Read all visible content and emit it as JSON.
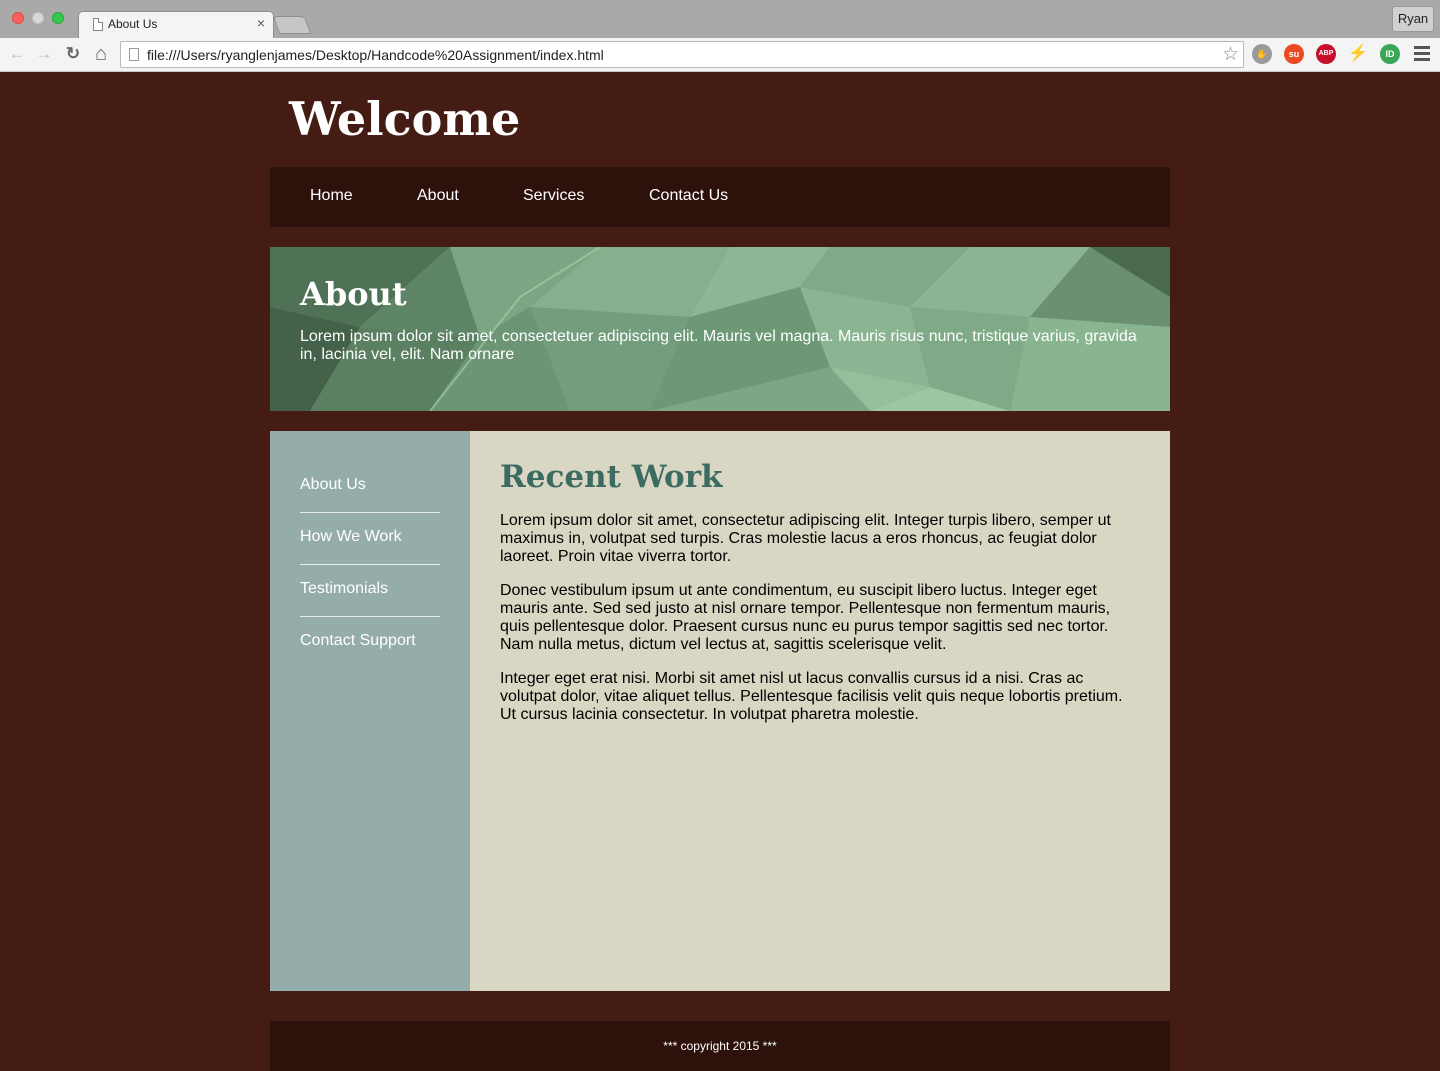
{
  "browser": {
    "tab_title": "About Us",
    "tab_close": "×",
    "profile_name": "Ryan",
    "url": "file:///Users/ryanglenjames/Desktop/Handcode%20Assignment/index.html",
    "toolbar_icons": {
      "back": "←",
      "forward": "→",
      "reload": "↻",
      "home": "⌂",
      "star": "☆"
    },
    "extensions": {
      "abp": "ABP",
      "stumble": "su",
      "bolt": "⚡",
      "idb": "ID"
    }
  },
  "site": {
    "title": "Welcome",
    "nav": [
      "Home",
      "About",
      "Services",
      "Contact Us"
    ]
  },
  "hero": {
    "title": "About",
    "text": "Lorem ipsum dolor sit amet, consectetuer adipiscing elit. Mauris vel magna. Mauris risus nunc, tristique varius, gravida in, lacinia vel, elit. Nam ornare"
  },
  "sidebar": {
    "links": [
      "About Us",
      "How We Work",
      "Testimonials",
      "Contact Support"
    ]
  },
  "main": {
    "title": "Recent Work",
    "paragraphs": [
      "Lorem ipsum dolor sit amet, consectetur adipiscing elit. Integer turpis libero, semper ut maximus in, volutpat sed turpis. Cras molestie lacus a eros rhoncus, ac feugiat dolor laoreet. Proin vitae viverra tortor.",
      "Donec vestibulum ipsum ut ante condimentum, eu suscipit libero luctus. Integer eget mauris ante. Sed sed justo at nisl ornare tempor. Pellentesque non fermentum mauris, quis pellentesque dolor. Praesent cursus nunc eu purus tempor sagittis sed nec tortor. Nam nulla metus, dictum vel lectus at, sagittis scelerisque velit.",
      "Integer eget erat nisi. Morbi sit amet nisl ut lacus convallis cursus id a nisi. Cras ac volutpat dolor, vitae aliquet tellus. Pellentesque facilisis velit quis neque lobortis pretium. Ut cursus lacinia consectetur. In volutpat pharetra molestie."
    ]
  },
  "footer": {
    "text": "*** copyright 2015 ***"
  },
  "colors": {
    "page_background": "#441c13",
    "nav_background": "#2d120c",
    "hero_green": "#6a9474",
    "sidebar": "#95adaa",
    "main_background": "#d9d7c3",
    "heading_teal": "#3c6b62"
  }
}
